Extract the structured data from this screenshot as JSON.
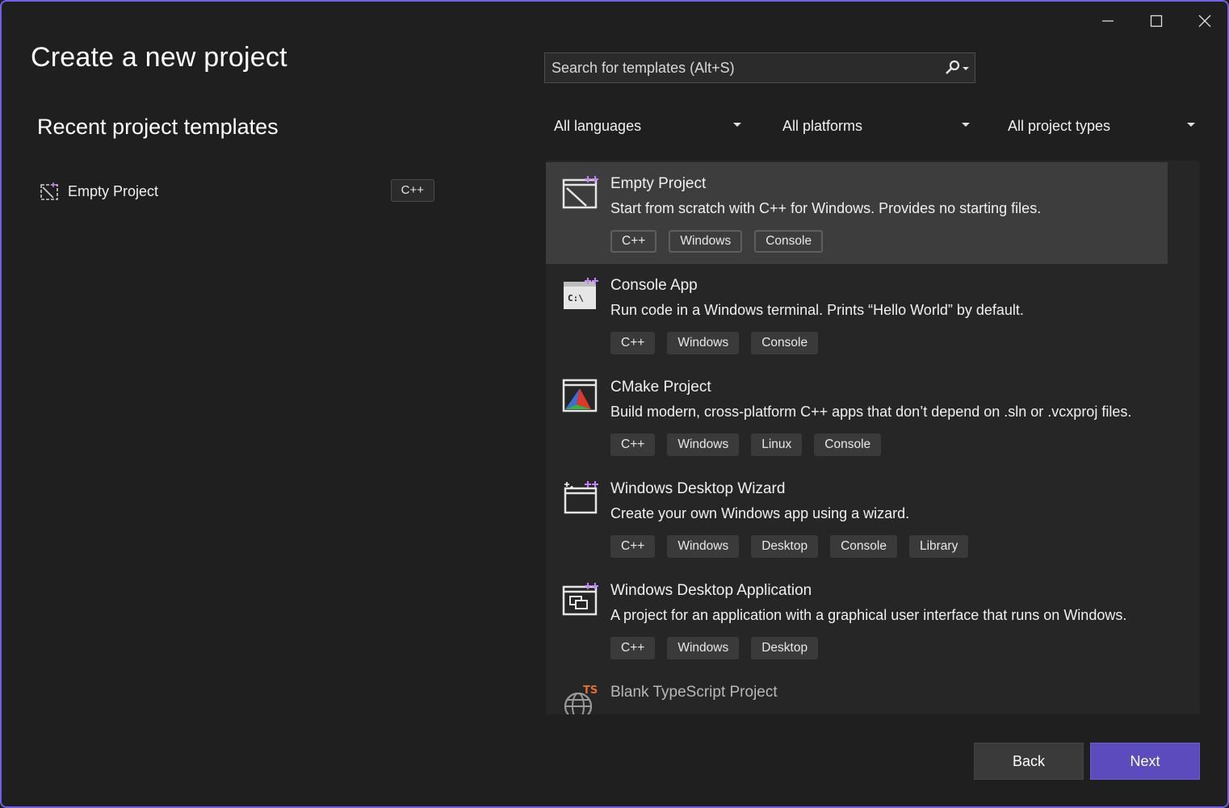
{
  "window": {
    "accent_color": "#7160e8",
    "controls": [
      "minimize-icon",
      "maximize-icon",
      "close-icon"
    ]
  },
  "page_title": "Create a new project",
  "recent": {
    "title": "Recent project templates",
    "items": [
      {
        "label": "Empty Project",
        "tag": "C++",
        "icon": "empty-project-icon"
      }
    ]
  },
  "search": {
    "placeholder": "Search for templates (Alt+S)",
    "value": "",
    "icon": "search-icon"
  },
  "filters": {
    "language": "All languages",
    "platform": "All platforms",
    "project_type": "All project types"
  },
  "templates": [
    {
      "name": "Empty Project",
      "description": "Start from scratch with C++ for Windows. Provides no starting files.",
      "tags": [
        "C++",
        "Windows",
        "Console"
      ],
      "icon": "empty-project-icon",
      "selected": true
    },
    {
      "name": "Console App",
      "description": "Run code in a Windows terminal. Prints “Hello World” by default.",
      "tags": [
        "C++",
        "Windows",
        "Console"
      ],
      "icon": "console-app-icon"
    },
    {
      "name": "CMake Project",
      "description": "Build modern, cross-platform C++ apps that don’t depend on .sln or .vcxproj files.",
      "tags": [
        "C++",
        "Windows",
        "Linux",
        "Console"
      ],
      "icon": "cmake-icon"
    },
    {
      "name": "Windows Desktop Wizard",
      "description": "Create your own Windows app using a wizard.",
      "tags": [
        "C++",
        "Windows",
        "Desktop",
        "Console",
        "Library"
      ],
      "icon": "wizard-icon"
    },
    {
      "name": "Windows Desktop Application",
      "description": "A project for an application with a graphical user interface that runs on Windows.",
      "tags": [
        "C++",
        "Windows",
        "Desktop"
      ],
      "icon": "desktop-app-icon"
    },
    {
      "name": "Blank TypeScript Project",
      "description": "",
      "tags": [],
      "icon": "typescript-project-icon"
    }
  ],
  "buttons": {
    "back": "Back",
    "next": "Next",
    "next_color": "#5b4bbd"
  }
}
